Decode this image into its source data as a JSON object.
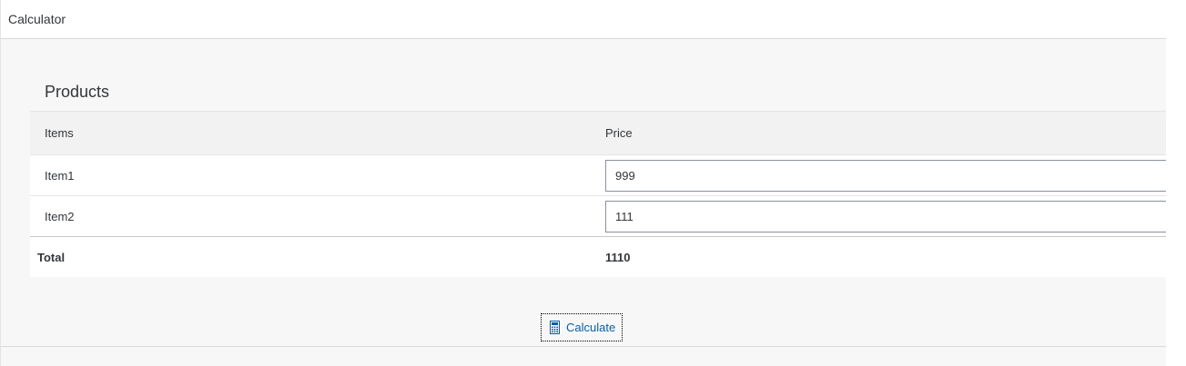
{
  "header": {
    "title": "Calculator"
  },
  "panel": {
    "title": "Products"
  },
  "table": {
    "columns": [
      "Items",
      "Price"
    ],
    "rows": [
      {
        "item": "Item1",
        "price": "999"
      },
      {
        "item": "Item2",
        "price": "111"
      }
    ],
    "total": {
      "label": "Total",
      "value": "1110"
    }
  },
  "actions": {
    "calculate_label": "Calculate",
    "calculate_icon": "calculator-icon"
  },
  "colors": {
    "accent": "#0b5ea8",
    "background": "#f7f7f7",
    "header_background": "#f2f2f2"
  }
}
